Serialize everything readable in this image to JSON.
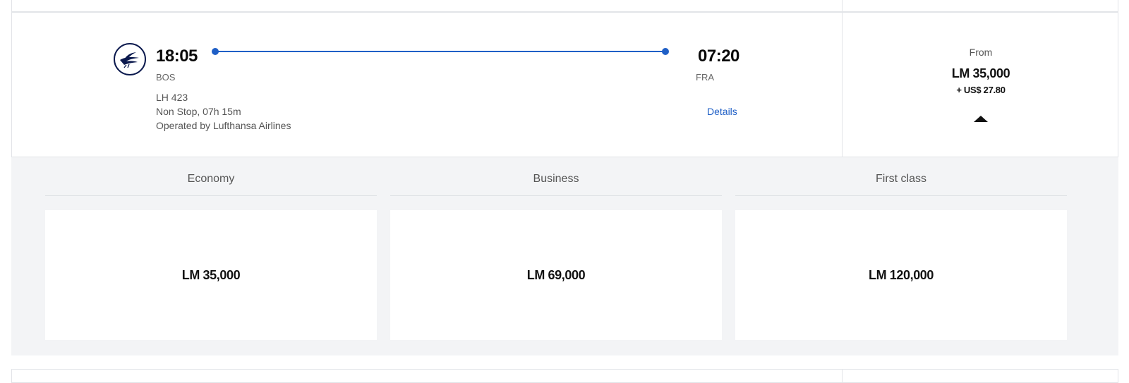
{
  "flight": {
    "departure_time": "18:05",
    "departure_code": "BOS",
    "arrival_time": "07:20",
    "arrival_code": "FRA",
    "flight_number": "LH 423",
    "duration": "Non Stop, 07h 15m",
    "operator": "Operated by Lufthansa Airlines",
    "details_label": "Details",
    "airline_logo_icon": "lufthansa-crane-logo"
  },
  "price": {
    "from_label": "From",
    "amount": "LM 35,000",
    "taxes": "+ US$ 27.80",
    "collapse_icon": "caret-up-icon"
  },
  "fares": [
    {
      "cabin": "Economy",
      "price": "LM 35,000"
    },
    {
      "cabin": "Business",
      "price": "LM 69,000"
    },
    {
      "cabin": "First class",
      "price": "LM 120,000"
    }
  ],
  "colors": {
    "accent_blue": "#1f5fc6",
    "logo_navy": "#0c1a4e",
    "panel_gray": "#f3f4f6",
    "border": "#e2e4e8"
  }
}
